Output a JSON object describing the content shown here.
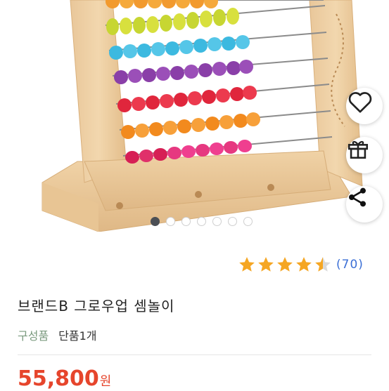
{
  "product": {
    "title": "브랜드B 그로우업 셈놀이",
    "option_label": "구성품",
    "option_value": "단품1개",
    "price": "55,800",
    "price_unit": "원"
  },
  "rating": {
    "score": 4.5,
    "max": 5,
    "review_count": "(70)",
    "star_color": "#f5a623"
  },
  "gallery": {
    "total_images": 7,
    "active_index": 0
  },
  "actions": {
    "wishlist_icon": "heart-icon",
    "gift_icon": "gift-icon",
    "share_icon": "share-icon"
  },
  "colors": {
    "price": "#e6452c",
    "review_link": "#3b6fd6",
    "option_label": "#7a9a7e"
  }
}
